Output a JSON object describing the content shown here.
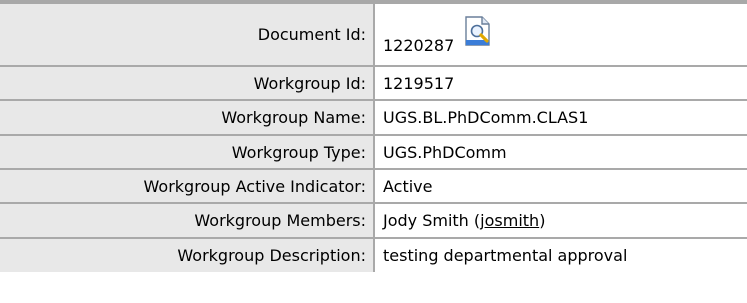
{
  "rows": {
    "document_id": {
      "label": "Document Id:",
      "value": "1220287"
    },
    "workgroup_id": {
      "label": "Workgroup Id:",
      "value": "1219517"
    },
    "workgroup_name": {
      "label": "Workgroup Name:",
      "value": "UGS.BL.PhDComm.CLAS1"
    },
    "workgroup_type": {
      "label": "Workgroup Type:",
      "value": "UGS.PhDComm"
    },
    "workgroup_active_indicator": {
      "label": "Workgroup Active Indicator:",
      "value": "Active"
    },
    "workgroup_members": {
      "label": "Workgroup Members:",
      "member_name": "Jody Smith",
      "open_paren": "(",
      "member_username": "josmith",
      "close_paren": ")"
    },
    "workgroup_description": {
      "label": "Workgroup Description:",
      "value": "testing departmental approval"
    }
  },
  "icons": {
    "document_search_icon": "document-magnifier"
  },
  "colors": {
    "label_background": "#e8e8e8",
    "value_background": "#ffffff",
    "border": "#a9a9a9",
    "icon_blue": "#3b7dd8",
    "icon_magnifier": "#e0a800"
  }
}
